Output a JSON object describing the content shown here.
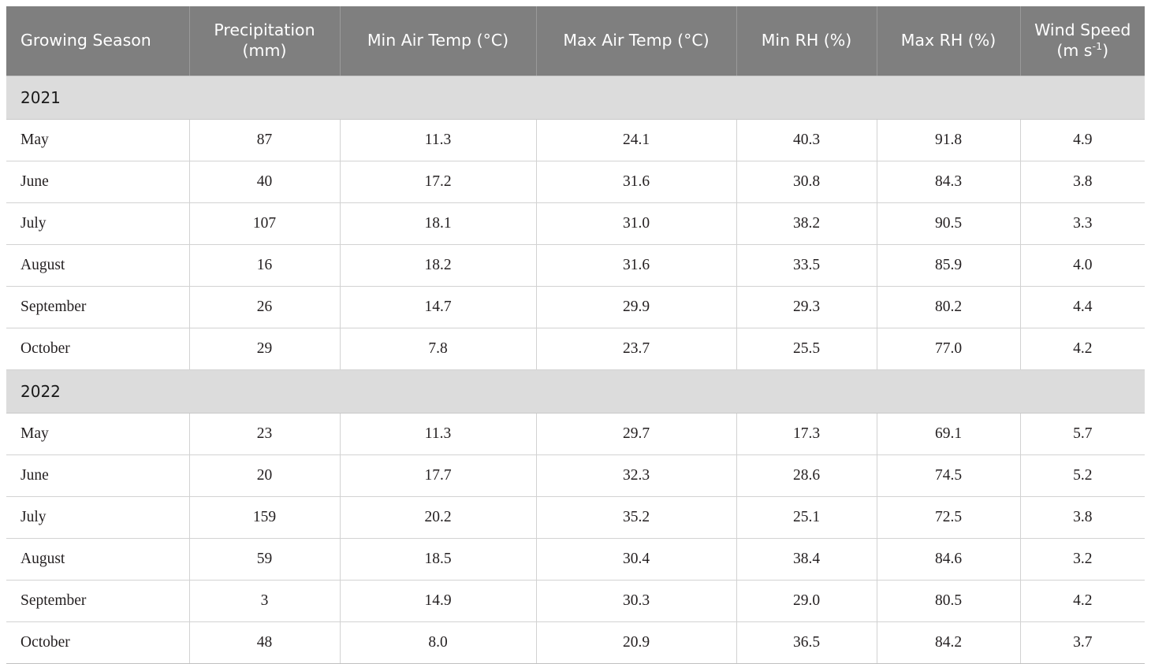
{
  "table": {
    "columns": [
      {
        "key": "season",
        "label_line1": "Growing Season",
        "label_line2": ""
      },
      {
        "key": "precip",
        "label_line1": "Precipitation",
        "label_line2": "(mm)"
      },
      {
        "key": "mintemp",
        "label_line1": "Min Air Temp (°C)",
        "label_line2": ""
      },
      {
        "key": "maxtemp",
        "label_line1": "Max Air Temp (°C)",
        "label_line2": ""
      },
      {
        "key": "minrh",
        "label_line1": "Min RH (%)",
        "label_line2": ""
      },
      {
        "key": "maxrh",
        "label_line1": "Max RH (%)",
        "label_line2": ""
      },
      {
        "key": "wind",
        "label_line1": "Wind Speed",
        "label_line2": "(m s",
        "label_sup": "-1",
        "label_line2_tail": ")"
      }
    ],
    "groups": [
      {
        "year": "2021",
        "rows": [
          {
            "season": "May",
            "precip": "87",
            "mintemp": "11.3",
            "maxtemp": "24.1",
            "minrh": "40.3",
            "maxrh": "91.8",
            "wind": "4.9"
          },
          {
            "season": "June",
            "precip": "40",
            "mintemp": "17.2",
            "maxtemp": "31.6",
            "minrh": "30.8",
            "maxrh": "84.3",
            "wind": "3.8"
          },
          {
            "season": "July",
            "precip": "107",
            "mintemp": "18.1",
            "maxtemp": "31.0",
            "minrh": "38.2",
            "maxrh": "90.5",
            "wind": "3.3"
          },
          {
            "season": "August",
            "precip": "16",
            "mintemp": "18.2",
            "maxtemp": "31.6",
            "minrh": "33.5",
            "maxrh": "85.9",
            "wind": "4.0"
          },
          {
            "season": "September",
            "precip": "26",
            "mintemp": "14.7",
            "maxtemp": "29.9",
            "minrh": "29.3",
            "maxrh": "80.2",
            "wind": "4.4"
          },
          {
            "season": "October",
            "precip": "29",
            "mintemp": "7.8",
            "maxtemp": "23.7",
            "minrh": "25.5",
            "maxrh": "77.0",
            "wind": "4.2"
          }
        ]
      },
      {
        "year": "2022",
        "rows": [
          {
            "season": "May",
            "precip": "23",
            "mintemp": "11.3",
            "maxtemp": "29.7",
            "minrh": "17.3",
            "maxrh": "69.1",
            "wind": "5.7"
          },
          {
            "season": "June",
            "precip": "20",
            "mintemp": "17.7",
            "maxtemp": "32.3",
            "minrh": "28.6",
            "maxrh": "74.5",
            "wind": "5.2"
          },
          {
            "season": "July",
            "precip": "159",
            "mintemp": "20.2",
            "maxtemp": "35.2",
            "minrh": "25.1",
            "maxrh": "72.5",
            "wind": "3.8"
          },
          {
            "season": "August",
            "precip": "59",
            "mintemp": "18.5",
            "maxtemp": "30.4",
            "minrh": "38.4",
            "maxrh": "84.6",
            "wind": "3.2"
          },
          {
            "season": "September",
            "precip": "3",
            "mintemp": "14.9",
            "maxtemp": "30.3",
            "minrh": "29.0",
            "maxrh": "80.5",
            "wind": "4.2"
          },
          {
            "season": "October",
            "precip": "48",
            "mintemp": "8.0",
            "maxtemp": "20.9",
            "minrh": "36.5",
            "maxrh": "84.2",
            "wind": "3.7"
          }
        ]
      }
    ]
  },
  "colors": {
    "header_background": "#7f7f7f",
    "header_text": "#ffffff",
    "group_background": "#dcdcdc",
    "group_text": "#1a1a1a",
    "cell_background": "#ffffff",
    "cell_text": "#231f20",
    "grid_line": "#d2d2d2"
  }
}
